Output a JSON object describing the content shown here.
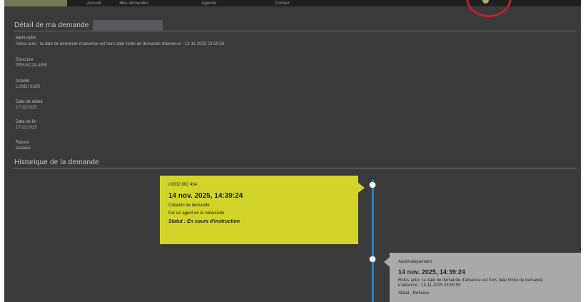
{
  "topbar": {
    "nav": [
      "Accueil",
      "Mes demandes",
      "Agenda",
      "Contact"
    ]
  },
  "detail": {
    "title": "Détail de ma demande",
    "status_code": "REFUSÉE",
    "status_message": "Refus auto : la date de demande d'absence est hors date limite de demande d'absence : 13-11-2025 23:59:59",
    "fields": [
      {
        "label": "Structure",
        "value": "PÉRISCOLAIRE"
      },
      {
        "label": "Activité",
        "value": "LUNDI SOIR"
      },
      {
        "label": "Date de début",
        "value": "17/11/2025"
      },
      {
        "label": "Date de fin",
        "value": "17/11/2025"
      },
      {
        "label": "Raison",
        "value": "Maladie"
      }
    ]
  },
  "history": {
    "title": "Historique de la demande",
    "events": [
      {
        "id": "#1002 802 434",
        "datetime": "14 nov. 2025, 14:39:24",
        "action": "Création de demande",
        "by": "Par un agent de la collectivité",
        "status": "Statut : En cours d'instruction"
      },
      {
        "id": "Automatiquement",
        "datetime": "14 nov. 2025, 14:39:24",
        "line1": "Refus auto : la date de demande d'absence est hors date limite de demande",
        "line2": "d'absence : 13-11-2025 23:59:59",
        "status": "Statut : Refusée"
      }
    ]
  },
  "colors": {
    "background": "#3a3a3b",
    "accent_yellow": "#d3d42a",
    "timeline_blue": "#2c7fc1",
    "annotation_red": "#b8242c"
  }
}
